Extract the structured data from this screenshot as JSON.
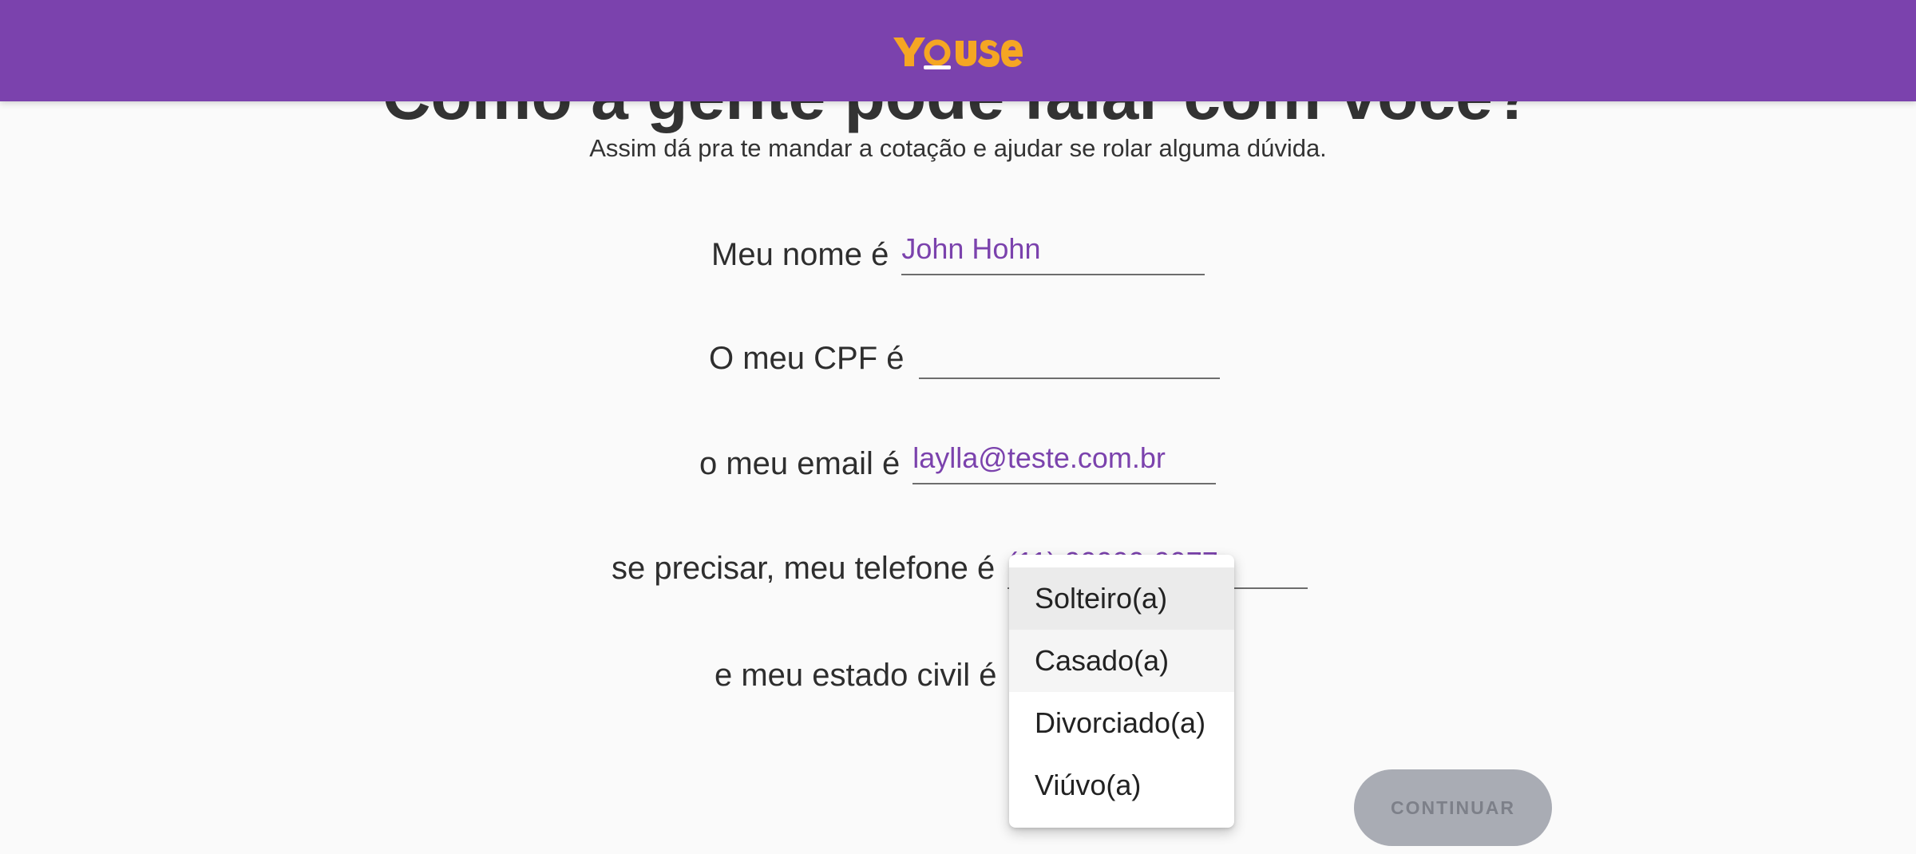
{
  "header": {
    "logo_text": "YOUSE",
    "brand_color": "#7b42ad",
    "logo_color": "#f5a623"
  },
  "page": {
    "title": "Como a gente pode falar com você?",
    "subtitle": "Assim dá pra te mandar a cotação e ajudar se rolar alguma dúvida."
  },
  "form": {
    "name": {
      "label": "Meu nome é",
      "value": "John Hohn"
    },
    "cpf": {
      "label": "O meu CPF é",
      "value": ""
    },
    "email": {
      "label": "o meu email é",
      "value": "laylla@teste.com.br"
    },
    "phone": {
      "label": "se precisar, meu telefone é",
      "value": "(11) 99999-9977"
    },
    "civil_status": {
      "label": "e meu estado civil é",
      "value": ""
    }
  },
  "dropdown": {
    "options": [
      "Solteiro(a)",
      "Casado(a)",
      "Divorciado(a)",
      "Viúvo(a)"
    ],
    "selected_index": 0,
    "hover_index": 1
  },
  "actions": {
    "continue_label": "CONTINUAR"
  }
}
